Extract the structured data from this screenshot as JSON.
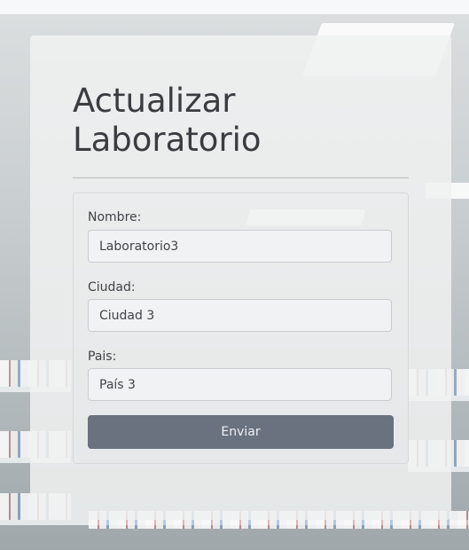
{
  "page": {
    "title": "Actualizar Laboratorio"
  },
  "form": {
    "fields": [
      {
        "label": "Nombre:",
        "value": "Laboratorio3"
      },
      {
        "label": "Ciudad:",
        "value": "Ciudad 3"
      },
      {
        "label": "Pais:",
        "value": "País 3"
      }
    ],
    "submit_label": "Enviar"
  },
  "colors": {
    "button": "#6a7280",
    "title": "#3a3d40"
  }
}
